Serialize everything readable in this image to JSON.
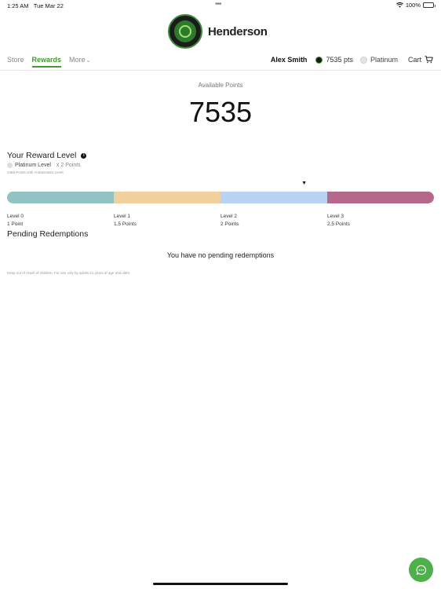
{
  "status_bar": {
    "time": "1:25 AM",
    "date": "Tue Mar 22",
    "battery": "100%"
  },
  "brand": {
    "name": "Henderson"
  },
  "nav": {
    "tabs": [
      {
        "label": "Store",
        "active": false
      },
      {
        "label": "Rewards",
        "active": true
      },
      {
        "label": "More",
        "active": false
      }
    ],
    "user_name": "Alex Smith",
    "points": "7535 pts",
    "tier": "Platinum",
    "cart_label": "Cart"
  },
  "points": {
    "label": "Available Points",
    "value": "7535"
  },
  "reward_level": {
    "title": "Your Reward Level",
    "current_level": "Platinum Level",
    "multiplier": "x 2 Points",
    "until_next": "2465 Points until Ambassador Level",
    "progress_fraction": 0.696,
    "segment_colors": [
      "#91c3c3",
      "#efd19b",
      "#b9d3f2",
      "#b5698a"
    ],
    "levels": [
      {
        "name": "Level 0",
        "points": "1 Point"
      },
      {
        "name": "Level 1",
        "points": "1.5 Points"
      },
      {
        "name": "Level 2",
        "points": "2 Points"
      },
      {
        "name": "Level 3",
        "points": "2.5 Points"
      }
    ]
  },
  "pending": {
    "title": "Pending Redemptions",
    "empty_message": "You have no pending redemptions"
  },
  "disclaimer": "Keep out of reach of children. For use only by adults 21 years of age and older.",
  "icons": {
    "wifi": "wifi-icon",
    "battery": "battery-icon",
    "cart": "cart-icon",
    "chat": "chat-icon",
    "info": "info-icon"
  },
  "colors": {
    "accent": "#3f9a2f",
    "chat_button": "#4db04a"
  }
}
